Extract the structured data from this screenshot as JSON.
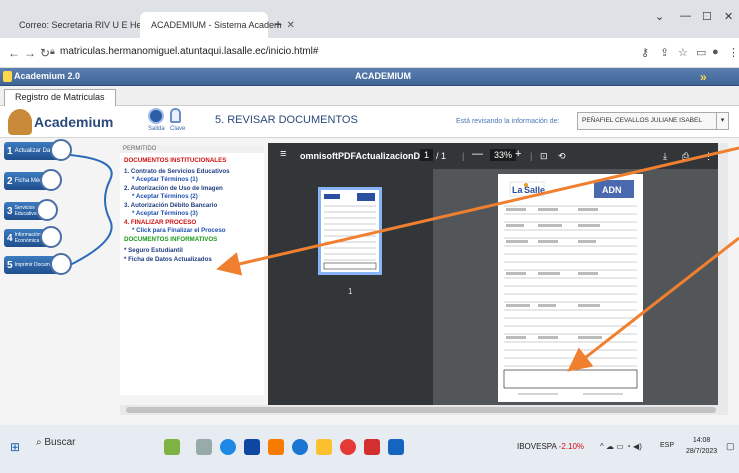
{
  "browser": {
    "tabs": [
      {
        "label": "Correo: Secretaria RIV U E Herma",
        "active": false
      },
      {
        "label": "ACADEMIUM - Sistema Academ",
        "active": true
      }
    ],
    "url": "matriculas.hermanomiguel.atuntaqui.lasalle.ec/inicio.html#"
  },
  "app": {
    "brand_small": "Academium 2.0",
    "center_title": "ACADEMIUM",
    "registro_tab": "Registro de Matriculas",
    "logo_text": "Academium",
    "salida_label": "Salida",
    "clave_label": "Clave",
    "step_title": "5. REVISAR DOCUMENTOS",
    "info_label": "Está revisando la información de:",
    "student_name": "PEÑAFIEL CEVALLOS JULIANE ISABEL"
  },
  "steps": [
    {
      "num": "1",
      "label": "Actualizar Datos"
    },
    {
      "num": "2",
      "label": "Ficha Médica"
    },
    {
      "num": "3",
      "label": "Servicios Educativos"
    },
    {
      "num": "4",
      "label": "Información Económica"
    },
    {
      "num": "5",
      "label": "Imprimir Documentos"
    }
  ],
  "docs": {
    "header": "PERMITIDO",
    "inst_title": "DOCUMENTOS INSTITUCIONALES",
    "d1": "1. Contrato de Servicios Educativos",
    "d1a": "* Aceptar Términos (1)",
    "d2": "2. Autorización de Uso de Imagen",
    "d2a": "* Aceptar Términos (2)",
    "d3": "3. Autorización Débito Bancario",
    "d3a": "* Aceptar Términos (3)",
    "d4": "4. FINALIZAR PROCESO",
    "d4a": "* Click para Finalizar el Proceso",
    "info_title": "DOCUMENTOS INFORMATIVOS",
    "i1": "* Seguro Estudiantil",
    "i2": "* Ficha de Datos Actualizados"
  },
  "pdf": {
    "filename": "omnisoftPDFActualizacionD...",
    "page_current": "1",
    "page_total": "/ 1",
    "zoom": "33%",
    "thumb_page": "1"
  },
  "taskbar": {
    "search": "Buscar",
    "stock_name": "IBOVESPA",
    "stock_change": "-2.10%",
    "lang": "ESP",
    "time": "14:08",
    "date": "28/7/2023"
  },
  "colors": {
    "accent": "#3f6496",
    "red": "#d01010",
    "green": "#1a9a1a",
    "arrow": "#f08030"
  }
}
